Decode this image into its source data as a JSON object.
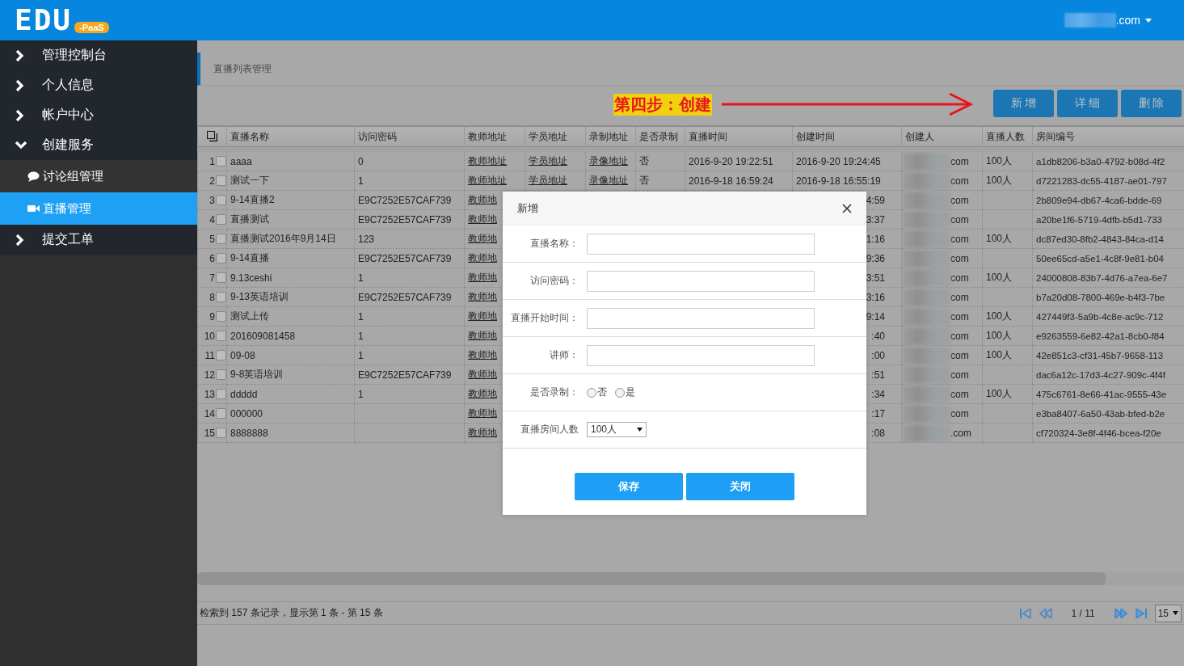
{
  "header": {
    "logo": "EDU",
    "logo_badge": "-PaaS",
    "user": ".com"
  },
  "sidebar": {
    "items": [
      {
        "label": "管理控制台",
        "expanded": false
      },
      {
        "label": "个人信息",
        "expanded": false
      },
      {
        "label": "帐户中心",
        "expanded": false
      },
      {
        "label": "创建服务",
        "expanded": true,
        "children": [
          {
            "label": "讨论组管理",
            "kind": "comment",
            "selected": false
          },
          {
            "label": "直播管理",
            "kind": "video",
            "selected": true
          }
        ]
      },
      {
        "label": "提交工单",
        "expanded": false
      }
    ]
  },
  "breadcrumb": "直播列表管理",
  "annotation": "第四步：创建",
  "toolbar": {
    "buttons": [
      "新 增",
      "详 细",
      "删 除"
    ]
  },
  "table": {
    "columns": [
      {
        "label": "直播名称"
      },
      {
        "label": "访问密码"
      },
      {
        "label": "教师地址",
        "kind": "link"
      },
      {
        "label": "学员地址",
        "kind": "link"
      },
      {
        "label": "录制地址",
        "kind": "link"
      },
      {
        "label": "是否录制"
      },
      {
        "label": "直播时间"
      },
      {
        "label": "创建时间"
      },
      {
        "label": "创建人",
        "kind": "blurred"
      },
      {
        "label": "直播人数"
      },
      {
        "label": "房间编号"
      }
    ],
    "rows": [
      {
        "index": "1",
        "checked": false,
        "cells": [
          "aaaa",
          "0",
          "教师地址",
          "学员地址",
          "录像地址",
          "否",
          "2016-9-20 19:22:51",
          "2016-9-20 19:24:45",
          "com",
          "100人",
          "a1db8206-b3a0-4792-b08d-4f2"
        ]
      },
      {
        "index": "2",
        "checked": false,
        "cells": [
          "测试一下",
          "1",
          "教师地址",
          "学员地址",
          "录像地址",
          "否",
          "2016-9-18 16:59:24",
          "2016-9-18 16:55:19",
          "com",
          "100人",
          "d7221283-dc55-4187-ae01-797"
        ]
      },
      {
        "index": "3",
        "checked": false,
        "cells": [
          "9-14直播2",
          "E9C7252E57CAF739",
          "教师地",
          null,
          null,
          null,
          null,
          {
            "text": "4:59",
            "partial": true
          },
          "com",
          null,
          "2b809e94-db67-4ca6-bdde-69"
        ]
      },
      {
        "index": "4",
        "checked": false,
        "cells": [
          "直播测试",
          "E9C7252E57CAF739",
          "教师地",
          null,
          null,
          null,
          null,
          {
            "text": "3:37",
            "partial": true
          },
          "com",
          null,
          "a20be1f6-5719-4dfb-b5d1-733"
        ]
      },
      {
        "index": "5",
        "checked": false,
        "cells": [
          "直播测试2016年9月14日",
          "123",
          "教师地",
          null,
          null,
          null,
          null,
          {
            "text": "1:16",
            "partial": true
          },
          "com",
          "100人",
          "dc87ed30-8fb2-4843-84ca-d14"
        ]
      },
      {
        "index": "6",
        "checked": false,
        "cells": [
          "9-14直播",
          "E9C7252E57CAF739",
          "教师地",
          null,
          null,
          null,
          null,
          {
            "text": "9:36",
            "partial": true
          },
          "com",
          null,
          "50ee65cd-a5e1-4c8f-9e81-b04"
        ]
      },
      {
        "index": "7",
        "checked": false,
        "cells": [
          "9.13ceshi",
          "1",
          "教师地",
          null,
          null,
          null,
          null,
          {
            "text": "3:51",
            "partial": true
          },
          "com",
          "100人",
          "24000808-83b7-4d76-a7ea-6e7"
        ]
      },
      {
        "index": "8",
        "checked": false,
        "cells": [
          "9-13英语培训",
          "E9C7252E57CAF739",
          "教师地",
          null,
          null,
          null,
          null,
          {
            "text": "3:16",
            "partial": true
          },
          "com",
          null,
          "b7a20d08-7800-469e-b4f3-7be"
        ]
      },
      {
        "index": "9",
        "checked": false,
        "cells": [
          "测试上传",
          "1",
          "教师地",
          null,
          null,
          null,
          null,
          {
            "text": "9:14",
            "partial": true
          },
          "com",
          "100人",
          "427449f3-5a9b-4c8e-ac9c-712"
        ]
      },
      {
        "index": "10",
        "checked": false,
        "cells": [
          "201609081458",
          "1",
          "教师地",
          null,
          null,
          null,
          null,
          {
            "text": ":40",
            "partial": true
          },
          "com",
          "100人",
          "e9263559-6e82-42a1-8cb0-f84"
        ]
      },
      {
        "index": "11",
        "checked": false,
        "cells": [
          "09-08",
          "1",
          "教师地",
          null,
          null,
          null,
          null,
          {
            "text": ":00",
            "partial": true
          },
          "com",
          "100人",
          "42e851c3-cf31-45b7-9658-113"
        ]
      },
      {
        "index": "12",
        "checked": false,
        "cells": [
          "9-8英语培训",
          "E9C7252E57CAF739",
          "教师地",
          null,
          null,
          null,
          null,
          {
            "text": ":51",
            "partial": true
          },
          "com",
          null,
          "dac6a12c-17d3-4c27-909c-4f4f"
        ]
      },
      {
        "index": "13",
        "checked": false,
        "cells": [
          "ddddd",
          "1",
          "教师地",
          null,
          null,
          null,
          null,
          {
            "text": ":34",
            "partial": true
          },
          "com",
          "100人",
          "475c6761-8e66-41ac-9555-43e"
        ]
      },
      {
        "index": "14",
        "checked": false,
        "cells": [
          "000000",
          null,
          "教师地",
          null,
          null,
          null,
          null,
          {
            "text": ":17",
            "partial": true
          },
          "com",
          null,
          "e3ba8407-6a50-43ab-bfed-b2e"
        ]
      },
      {
        "index": "15",
        "checked": false,
        "cells": [
          "8888888",
          null,
          "教师地",
          null,
          null,
          null,
          null,
          {
            "text": ":08",
            "partial": true
          },
          ".com",
          null,
          "cf720324-3e8f-4f46-bcea-f20e"
        ]
      }
    ]
  },
  "pager": {
    "summary": "检索到 157 条记录，显示第 1 条 - 第 15 条",
    "page": "1 / 11",
    "page_size": "15"
  },
  "dialog": {
    "title": "新增",
    "fields": [
      {
        "label": "直播名称：",
        "kind": "text"
      },
      {
        "label": "访问密码：",
        "kind": "text"
      },
      {
        "label": "直播开始时间：",
        "kind": "text"
      },
      {
        "label": "讲师：",
        "kind": "text"
      },
      {
        "label": "是否录制：",
        "kind": "radio",
        "options": [
          {
            "label": "否",
            "selected": false
          },
          {
            "label": "是",
            "selected": false
          }
        ]
      },
      {
        "label": "直播房间人数",
        "kind": "select",
        "value": "100人"
      }
    ],
    "buttons": [
      "保存",
      "关闭"
    ]
  }
}
